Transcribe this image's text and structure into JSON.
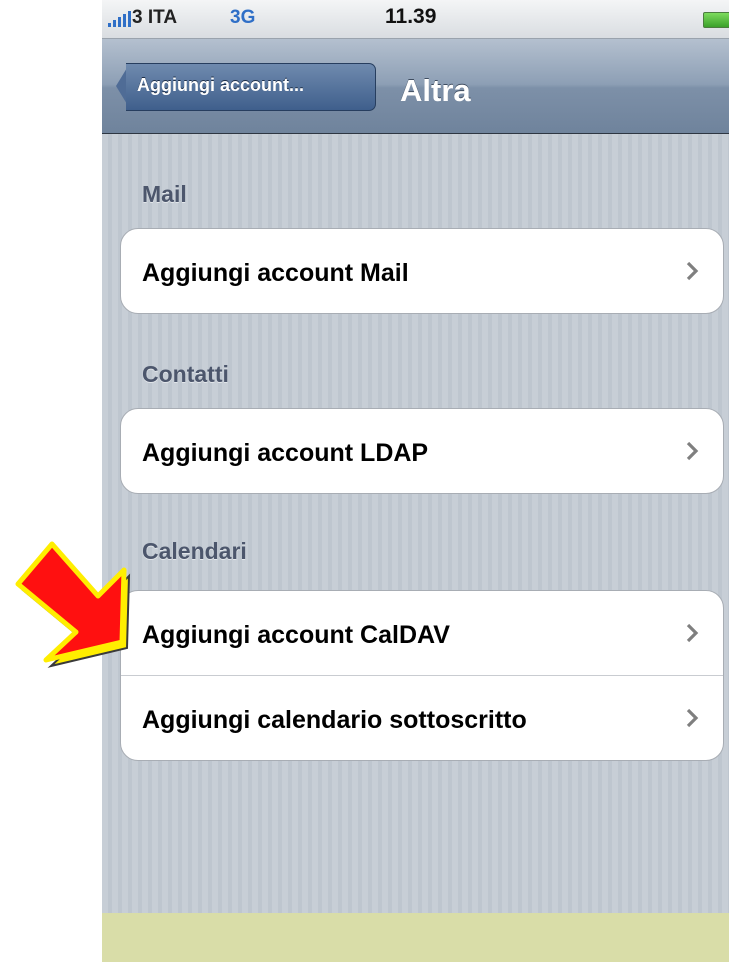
{
  "status_bar": {
    "carrier": "3 ITA",
    "network": "3G",
    "time": "11.39"
  },
  "navbar": {
    "back_label": "Aggiungi account...",
    "title": "Altra"
  },
  "sections": [
    {
      "header": "Mail",
      "rows": [
        "Aggiungi account Mail"
      ]
    },
    {
      "header": "Contatti",
      "rows": [
        "Aggiungi account LDAP"
      ]
    },
    {
      "header": "Calendari",
      "rows": [
        "Aggiungi account CalDAV",
        "Aggiungi calendario sottoscritto"
      ]
    }
  ],
  "colors": {
    "annotation_arrow_fill": "#ff0000",
    "annotation_arrow_outline": "#ffee00",
    "accent": "#2f6fc7"
  }
}
